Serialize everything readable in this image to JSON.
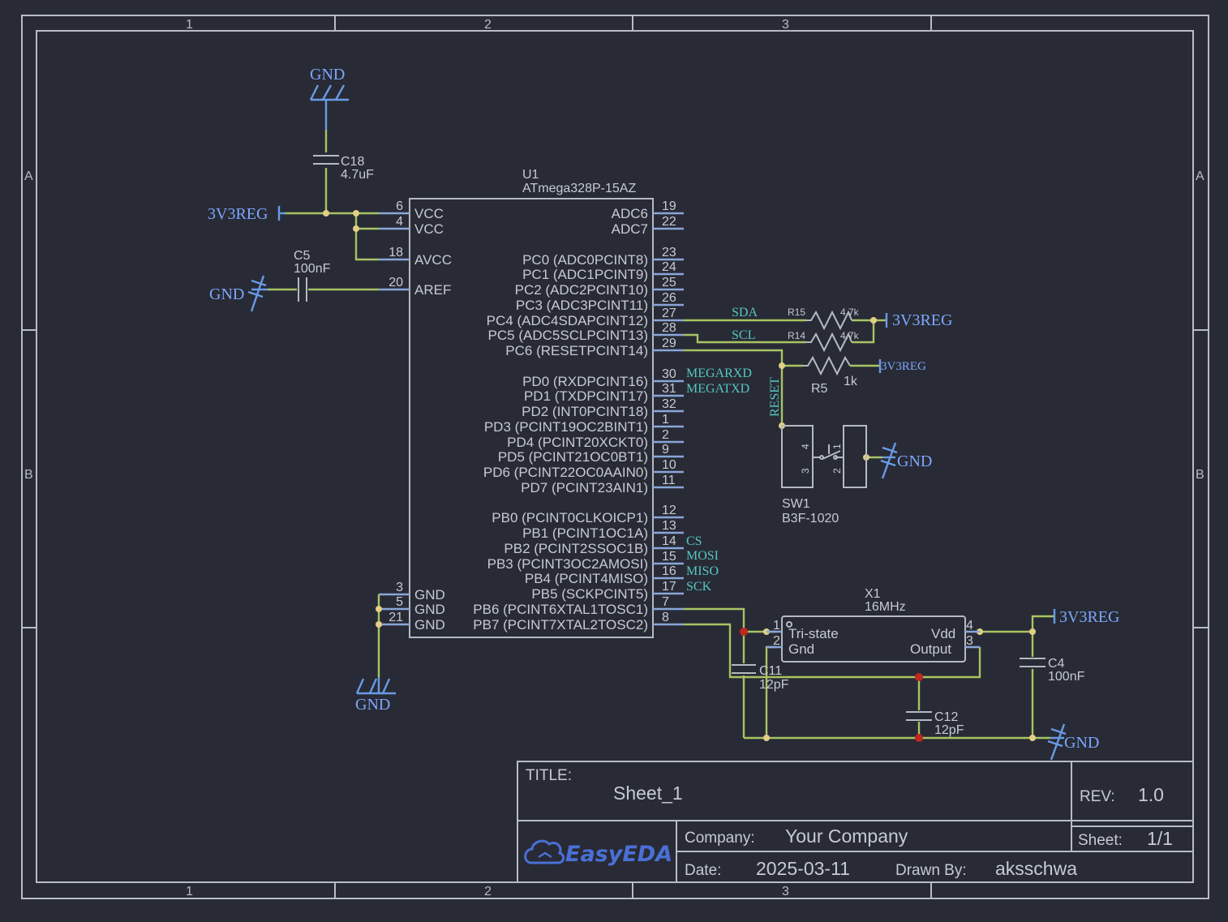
{
  "frame": {
    "columns": [
      "1",
      "2",
      "3"
    ],
    "rows": [
      "A",
      "B"
    ]
  },
  "colors": {
    "background": "#282b35",
    "wire": "#a7c463",
    "pin": "#8aa6d8",
    "power": "#7ea6ff",
    "net_label": "#57c6c4",
    "junction": "#e2cf86",
    "junction_red": "#c0281f"
  },
  "u1": {
    "designator": "U1",
    "part": "ATmega328P-15AZ",
    "left_pins": [
      {
        "num": "6",
        "name": "VCC"
      },
      {
        "num": "4",
        "name": "VCC"
      },
      {
        "num": "18",
        "name": "AVCC"
      },
      {
        "num": "20",
        "name": "AREF"
      },
      {
        "num": "3",
        "name": "GND"
      },
      {
        "num": "5",
        "name": "GND"
      },
      {
        "num": "21",
        "name": "GND"
      }
    ],
    "right_pins": [
      {
        "num": "19",
        "name": "ADC6"
      },
      {
        "num": "22",
        "name": "ADC7"
      },
      {
        "num": "23",
        "name": "PC0 (ADC0PCINT8)"
      },
      {
        "num": "24",
        "name": "PC1 (ADC1PCINT9)"
      },
      {
        "num": "25",
        "name": "PC2 (ADC2PCINT10)"
      },
      {
        "num": "26",
        "name": "PC3 (ADC3PCINT11)"
      },
      {
        "num": "27",
        "name": "PC4 (ADC4SDAPCINT12)"
      },
      {
        "num": "28",
        "name": "PC5 (ADC5SCLPCINT13)"
      },
      {
        "num": "29",
        "name": "PC6 (RESETPCINT14)"
      },
      {
        "num": "30",
        "name": "PD0 (RXDPCINT16)"
      },
      {
        "num": "31",
        "name": "PD1 (TXDPCINT17)"
      },
      {
        "num": "32",
        "name": "PD2 (INT0PCINT18)"
      },
      {
        "num": "1",
        "name": "PD3 (PCINT19OC2BINT1)"
      },
      {
        "num": "2",
        "name": "PD4 (PCINT20XCKT0)"
      },
      {
        "num": "9",
        "name": "PD5 (PCINT21OC0BT1)"
      },
      {
        "num": "10",
        "name": "PD6 (PCINT22OC0AAIN0)"
      },
      {
        "num": "11",
        "name": "PD7 (PCINT23AIN1)"
      },
      {
        "num": "12",
        "name": "PB0 (PCINT0CLKOICP1)"
      },
      {
        "num": "13",
        "name": "PB1 (PCINT1OC1A)"
      },
      {
        "num": "14",
        "name": "PB2 (PCINT2SSOC1B)"
      },
      {
        "num": "15",
        "name": "PB3 (PCINT3OC2AMOSI)"
      },
      {
        "num": "16",
        "name": "PB4 (PCINT4MISO)"
      },
      {
        "num": "17",
        "name": "PB5 (SCKPCINT5)"
      },
      {
        "num": "7",
        "name": "PB6 (PCINT6XTAL1TOSC1)"
      },
      {
        "num": "8",
        "name": "PB7 (PCINT7XTAL2TOSC2)"
      }
    ]
  },
  "net_labels": {
    "sda": "SDA",
    "scl": "SCL",
    "megarxd": "MEGARXD",
    "megatxd": "MEGATXD",
    "cs": "CS",
    "mosi": "MOSI",
    "miso": "MISO",
    "sck": "SCK",
    "reset": "RESET"
  },
  "power": {
    "gnd": "GND",
    "v33": "3V3REG"
  },
  "components": {
    "c18": {
      "designator": "C18",
      "value": "4.7uF"
    },
    "c5": {
      "designator": "C5",
      "value": "100nF"
    },
    "r15": {
      "designator": "R15",
      "value": "4.7k"
    },
    "r14": {
      "designator": "R14",
      "value": "4.7k"
    },
    "r5": {
      "designator": "R5",
      "value": "1k"
    },
    "sw1": {
      "designator": "SW1",
      "part": "B3F-1020",
      "pins": [
        "4",
        "3",
        "1",
        "2"
      ]
    },
    "x1": {
      "designator": "X1",
      "value": "16MHz",
      "pin_tristate": "Tri-state",
      "pin_gnd": "Gnd",
      "pin_vdd": "Vdd",
      "pin_output": "Output",
      "pins": [
        "1",
        "2",
        "4",
        "3"
      ]
    },
    "c11": {
      "designator": "C11",
      "value": "12pF"
    },
    "c12": {
      "designator": "C12",
      "value": "12pF"
    },
    "c4": {
      "designator": "C4",
      "value": "100nF"
    }
  },
  "title_block": {
    "title_label": "TITLE:",
    "title": "Sheet_1",
    "rev_label": "REV:",
    "rev": "1.0",
    "company_label": "Company:",
    "company": "Your Company",
    "sheet_label": "Sheet:",
    "sheet": "1/1",
    "date_label": "Date:",
    "date": "2025-03-11",
    "drawn_label": "Drawn By:",
    "drawn_by": "aksschwa",
    "logo": "EasyEDA"
  }
}
